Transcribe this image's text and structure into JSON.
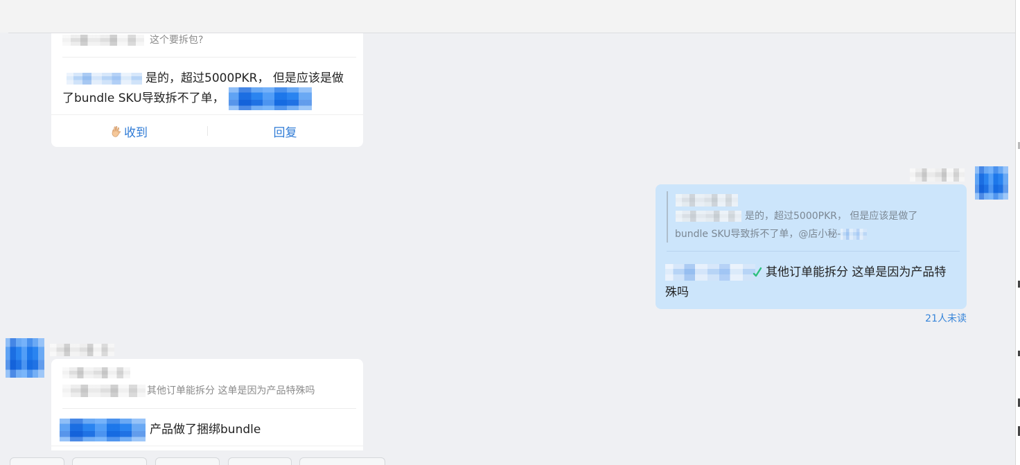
{
  "colors": {
    "page_bg": "#eff0f3",
    "header_bg": "#f3f3f3",
    "card_bg": "#ffffff",
    "own_bubble_bg": "#cce5fb",
    "text_primary": "#222222",
    "text_quote": "#8a8a8a",
    "own_quote_text": "#7b8793",
    "action_blue": "#2f7bd6",
    "read_status_blue": "#3584d9"
  },
  "icons": {
    "acknowledge_button": "ok-hand-icon",
    "sender_badge": "green-check-icon"
  },
  "messages": [
    {
      "quote": {
        "text": "这个要拆包?"
      },
      "body": {
        "lines": [
          "是的，超过5000PKR， 但是应该是做",
          "了bundle SKU导致拆不了单，"
        ]
      },
      "actions": {
        "ack_label": "收到",
        "reply_label": "回复"
      }
    },
    {
      "quote": {
        "lines": [
          "是的，超过5000PKR， 但是应该是做了",
          "bundle SKU导致拆不了单，@店小秘-"
        ]
      },
      "body": {
        "lines": [
          "其他订单能拆分 这单是因为产品特",
          "殊吗"
        ]
      },
      "read_status": "21人未读"
    },
    {
      "quote": {
        "text": "其他订单能拆分 这单是因为产品特殊吗"
      },
      "body": {
        "lines": [
          "产品做了捆绑bundle"
        ]
      }
    }
  ]
}
